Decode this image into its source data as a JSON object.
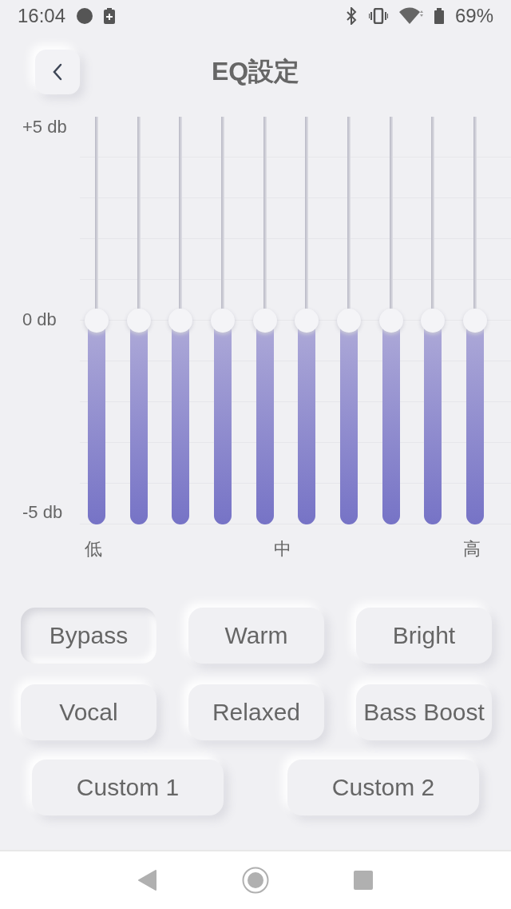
{
  "status_bar": {
    "time": "16:04",
    "battery": "69%"
  },
  "header": {
    "title": "EQ設定"
  },
  "scale": {
    "top": "+5 db",
    "middle": "0 db",
    "bottom": "-5 db"
  },
  "bands": [
    {
      "level": 0.5
    },
    {
      "level": 0.5
    },
    {
      "level": 0.5
    },
    {
      "level": 0.5
    },
    {
      "level": 0.5
    },
    {
      "level": 0.5
    },
    {
      "level": 0.5
    },
    {
      "level": 0.5
    },
    {
      "level": 0.5
    },
    {
      "level": 0.5
    }
  ],
  "band_labels": [
    "低",
    "中",
    "高"
  ],
  "presets": [
    {
      "label": "Bypass",
      "selected": true
    },
    {
      "label": "Warm",
      "selected": false
    },
    {
      "label": "Bright",
      "selected": false
    },
    {
      "label": "Vocal",
      "selected": false
    },
    {
      "label": "Relaxed",
      "selected": false
    },
    {
      "label": "Bass Boost",
      "selected": false
    }
  ],
  "custom_presets": [
    {
      "label": "Custom 1",
      "selected": false
    },
    {
      "label": "Custom 2",
      "selected": false
    }
  ]
}
